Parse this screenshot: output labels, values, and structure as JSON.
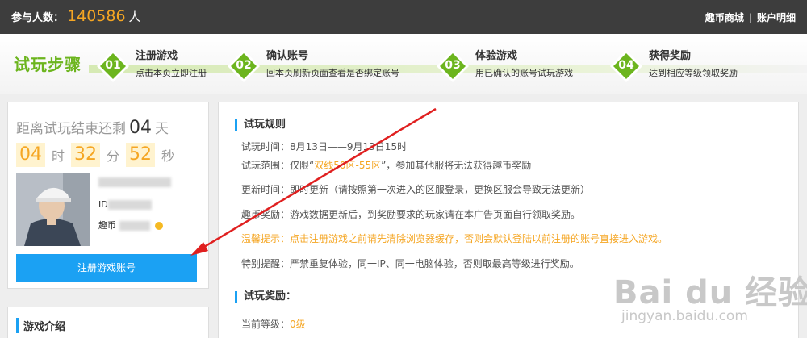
{
  "header": {
    "participants_label": "参与人数：",
    "participants_count": "140586",
    "participants_unit": "人",
    "links": [
      "趣币商城",
      "账户明细"
    ],
    "separator": "|"
  },
  "steps": {
    "title": "试玩步骤",
    "items": [
      {
        "num": "01",
        "title": "注册游戏",
        "desc": "点击本页立即注册"
      },
      {
        "num": "02",
        "title": "确认账号",
        "desc": "回本页刷新页面查看是否绑定账号"
      },
      {
        "num": "03",
        "title": "体验游戏",
        "desc": "用已确认的账号试玩游戏"
      },
      {
        "num": "04",
        "title": "获得奖励",
        "desc": "达到相应等级领取奖励"
      }
    ]
  },
  "countdown": {
    "prefix": "距离试玩结束还剩",
    "days": "04",
    "days_label": "天",
    "hours": "04",
    "hours_label": "时",
    "minutes": "32",
    "minutes_label": "分",
    "seconds": "52",
    "seconds_label": "秒"
  },
  "user": {
    "id_label": "ID",
    "coin_label": "趣币"
  },
  "register_button": "注册游戏账号",
  "intro": {
    "title": "游戏介绍"
  },
  "rules": {
    "title": "试玩规则",
    "time": "试玩时间：8月13日——9月13日15时",
    "range_prefix": "试玩范围：仅限“",
    "range_highlight": "双线50区-55区",
    "range_suffix": "”，参加其他服将无法获得趣币奖励",
    "update": "更新时间：即时更新（请按照第一次进入的区服登录，更换区服会导致无法更新）",
    "reward": "趣币奖励：游戏数据更新后，到奖励要求的玩家请在本广告页面自行领取奖励。",
    "warning": "温馨提示：点击注册游戏之前请先清除浏览器缓存，否则会默认登陆以前注册的账号直接进入游戏。",
    "special": "特别提醒：严禁重复体验，同一IP、同一电脑体验，否则取最高等级进行奖励。"
  },
  "rewards": {
    "title": "试玩奖励：",
    "level_label": "当前等级：",
    "level_value": "0级"
  },
  "watermark": {
    "logo": "Bai du 经验",
    "url": "jingyan.baidu.com"
  },
  "colors": {
    "accent_blue": "#1ba1f3",
    "accent_orange": "#f5a623",
    "step_green": "#6cb51e",
    "arrow_red": "#e02020"
  }
}
